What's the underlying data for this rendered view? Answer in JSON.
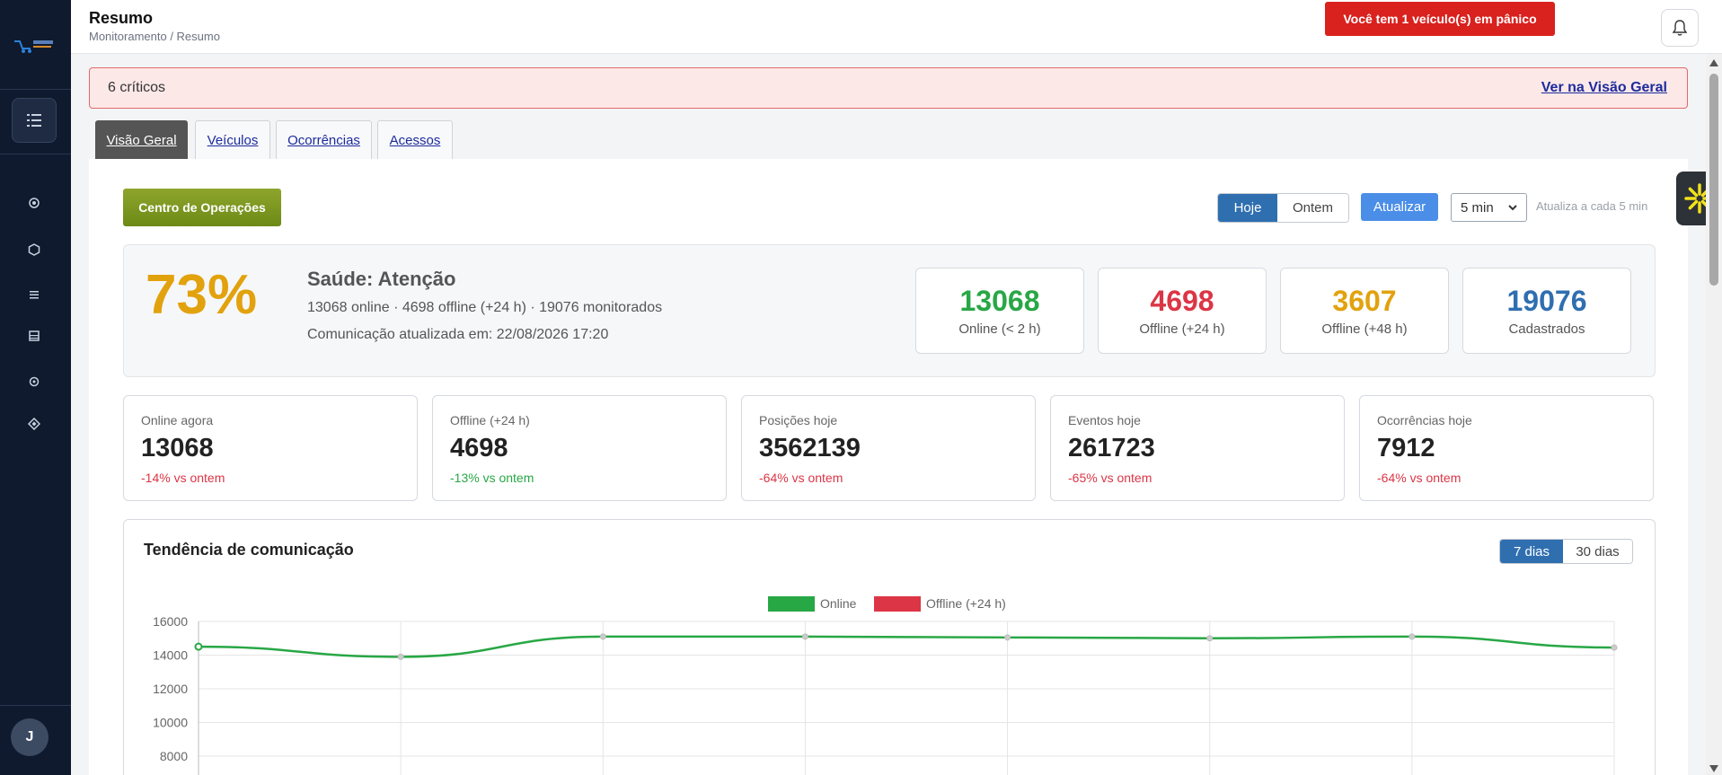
{
  "header": {
    "title": "Resumo",
    "breadcrumb": "Monitoramento / Resumo",
    "panic_label": "Você tem 1 veículo(s) em pânico"
  },
  "sidebar": {
    "items": [
      "home-icon",
      "hexagon-icon",
      "list-icon",
      "table-icon",
      "settings-icon",
      "diamond-icon"
    ],
    "avatar_initial": "J"
  },
  "alert": {
    "text": "6 críticos",
    "link": "Ver na Visão Geral"
  },
  "tabs": [
    {
      "label": "Visão Geral",
      "active": true
    },
    {
      "label": "Veículos",
      "active": false
    },
    {
      "label": "Ocorrências",
      "active": false
    },
    {
      "label": "Acessos",
      "active": false
    }
  ],
  "controls": {
    "ops_button": "Centro de Operações",
    "today": "Hoje",
    "yesterday": "Ontem",
    "refresh": "Atualizar",
    "interval": "5 min",
    "auto_text": "Atualiza a cada 5 min"
  },
  "health": {
    "percent": "73%",
    "title": "Saúde: Atenção",
    "line1": "13068 online · 4698 offline (+24 h) · 19076 monitorados",
    "line2": "Comunicação atualizada em: 22/08/2026 17:20"
  },
  "stats": [
    {
      "value": "13068",
      "label": "Online (< 2 h)",
      "color": "#28a745"
    },
    {
      "value": "4698",
      "label": "Offline (+24 h)",
      "color": "#dc3545"
    },
    {
      "value": "3607",
      "label": "Offline (+48 h)",
      "color": "#e2a20d"
    },
    {
      "value": "19076",
      "label": "Cadastrados",
      "color": "#2f6fb0"
    }
  ],
  "metrics": [
    {
      "label": "Online agora",
      "value": "13068",
      "delta": "-14% vs ontem",
      "delta_color": "#dc3545"
    },
    {
      "label": "Offline (+24 h)",
      "value": "4698",
      "delta": "-13% vs ontem",
      "delta_color": "#28a745"
    },
    {
      "label": "Posições hoje",
      "value": "3562139",
      "delta": "-64% vs ontem",
      "delta_color": "#dc3545"
    },
    {
      "label": "Eventos hoje",
      "value": "261723",
      "delta": "-65% vs ontem",
      "delta_color": "#dc3545"
    },
    {
      "label": "Ocorrências hoje",
      "value": "7912",
      "delta": "-64% vs ontem",
      "delta_color": "#dc3545"
    }
  ],
  "trend": {
    "title": "Tendência de comunicação",
    "range_7": "7 dias",
    "range_30": "30 dias"
  },
  "chart_data": {
    "type": "line",
    "ylim": [
      8000,
      16000
    ],
    "yticks": [
      16000,
      14000,
      12000,
      10000,
      8000
    ],
    "grid": true,
    "legend_position": "top-center",
    "series": [
      {
        "name": "Online",
        "color": "#28a745",
        "values": [
          14500,
          13900,
          15100,
          15100,
          15050,
          15000,
          15100,
          14450
        ]
      },
      {
        "name": "Offline (+24 h)",
        "color": "#dc3545",
        "values": []
      }
    ]
  }
}
